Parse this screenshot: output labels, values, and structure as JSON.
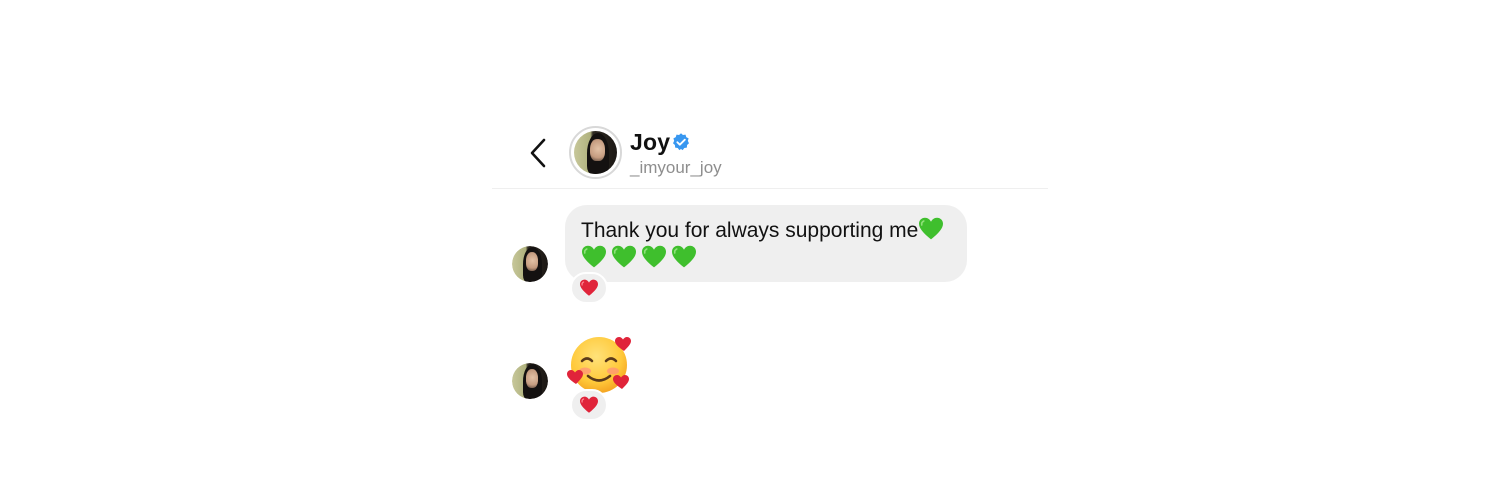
{
  "header": {
    "back_icon": "chevron-left-icon",
    "name": "Joy",
    "verified_icon": "verified-badge-icon",
    "handle": "_imyour_joy"
  },
  "messages": [
    {
      "text": "Thank you for always supporting me",
      "trailing_emoji": "green-heart",
      "reaction": "red-heart"
    },
    {
      "emoji": "smiling-face-with-hearts",
      "reaction": "red-heart"
    }
  ],
  "colors": {
    "bubble": "#efefef",
    "verified": "#3897f0",
    "handle": "#8e8e8e",
    "green_heart": "#3fbf2d",
    "red_heart": "#e0243a"
  }
}
